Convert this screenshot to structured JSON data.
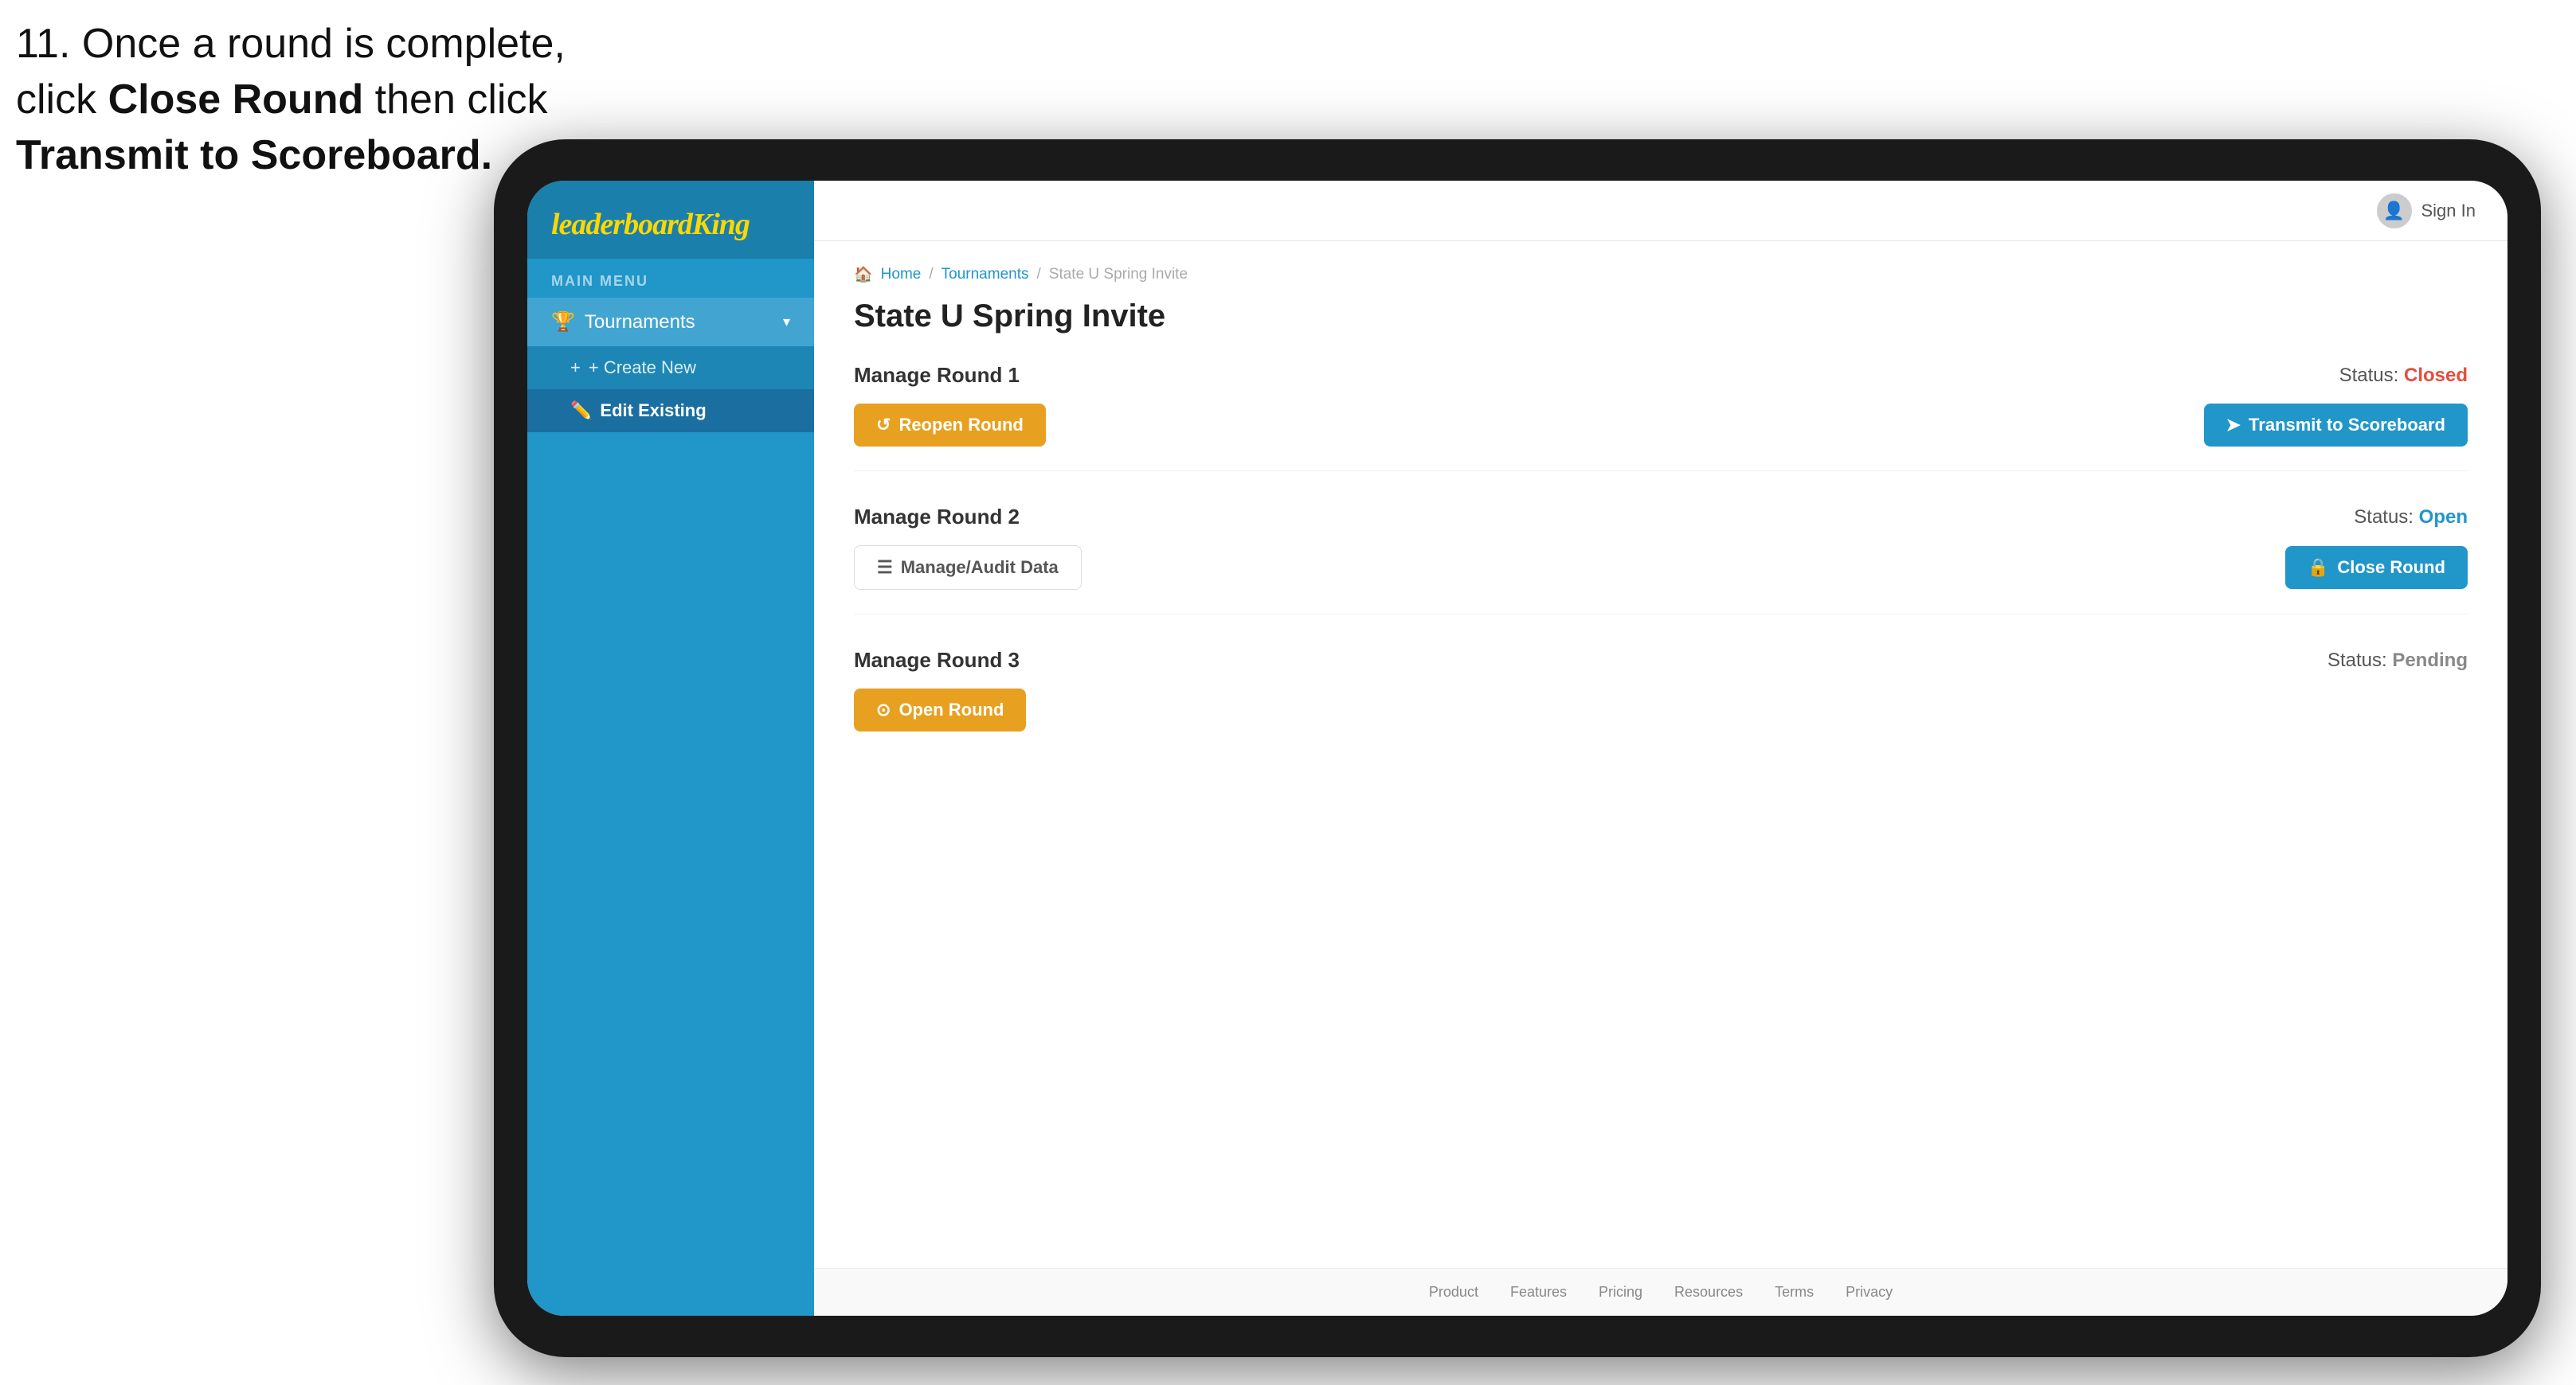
{
  "instruction": {
    "line1": "11. Once a round is complete,",
    "line2": "click ",
    "bold1": "Close Round",
    "line3": " then click",
    "bold2": "Transmit to Scoreboard."
  },
  "logo": {
    "text_normal": "leaderboard",
    "text_styled": "King"
  },
  "sidebar": {
    "menu_label": "MAIN MENU",
    "tournaments_label": "Tournaments",
    "chevron": "▾",
    "create_new_label": "+ Create New",
    "edit_existing_label": "Edit Existing"
  },
  "header": {
    "sign_in_label": "Sign In"
  },
  "breadcrumb": {
    "home": "Home",
    "separator1": "/",
    "tournaments": "Tournaments",
    "separator2": "/",
    "current": "State U Spring Invite"
  },
  "page": {
    "title": "State U Spring Invite"
  },
  "rounds": [
    {
      "id": "round1",
      "title": "Manage Round 1",
      "status_label": "Status:",
      "status_value": "Closed",
      "status_type": "closed",
      "left_button_label": "Reopen Round",
      "left_button_icon": "↺",
      "right_button_label": "Transmit to Scoreboard",
      "right_button_icon": "➤",
      "right_button_type": "blue"
    },
    {
      "id": "round2",
      "title": "Manage Round 2",
      "status_label": "Status:",
      "status_value": "Open",
      "status_type": "open",
      "left_button_label": "Manage/Audit Data",
      "left_button_icon": "☰",
      "right_button_label": "Close Round",
      "right_button_icon": "🔒",
      "right_button_type": "blue"
    },
    {
      "id": "round3",
      "title": "Manage Round 3",
      "status_label": "Status:",
      "status_value": "Pending",
      "status_type": "pending",
      "left_button_label": "Open Round",
      "left_button_icon": "⊙",
      "right_button_label": null,
      "right_button_type": null
    }
  ],
  "footer": {
    "links": [
      "Product",
      "Features",
      "Pricing",
      "Resources",
      "Terms",
      "Privacy"
    ]
  }
}
